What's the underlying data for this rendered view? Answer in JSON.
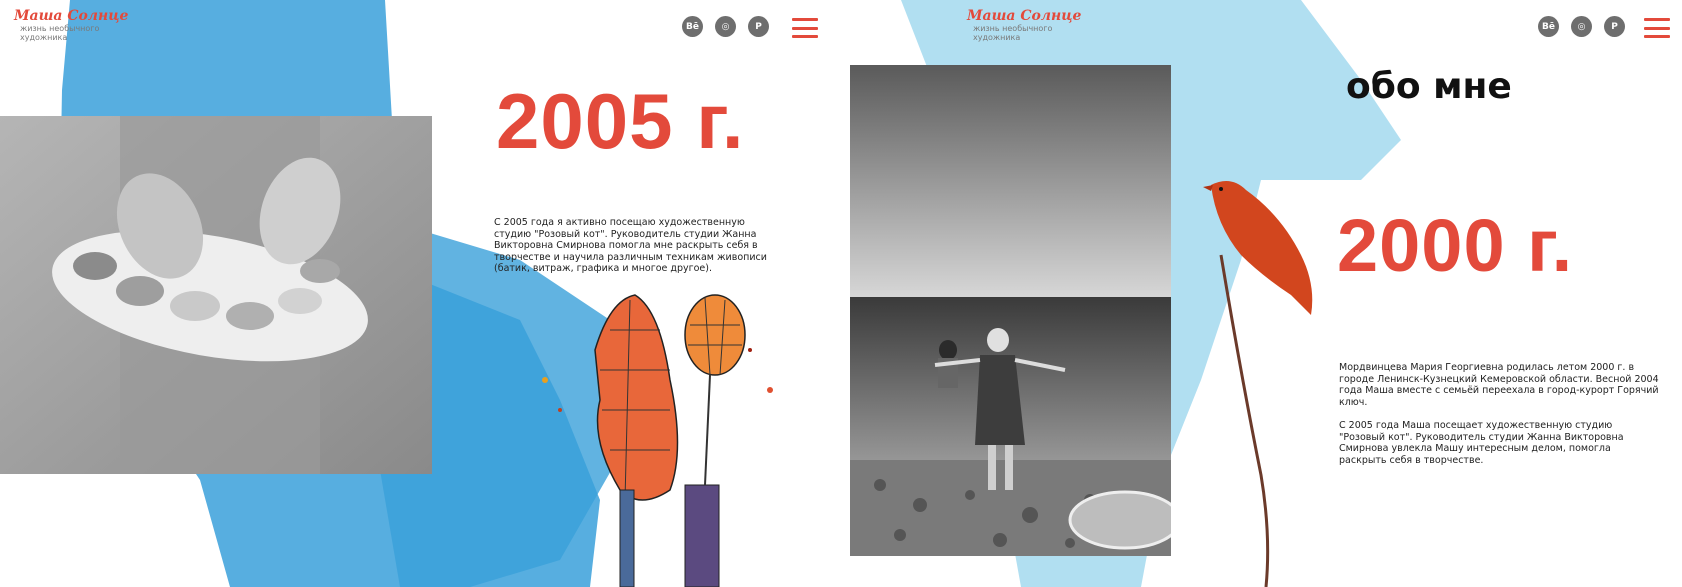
{
  "brand": {
    "logo": "Маша Солнце",
    "tagline": "жизнь необычного художника"
  },
  "social": {
    "behance": "Bē",
    "instagram": "◎",
    "pinterest": "P"
  },
  "colors": {
    "accent": "#e34a3b",
    "splash_blue": "#3aa0da",
    "splash_light": "#a9dcef"
  },
  "left_slide": {
    "year": "2005 г.",
    "text": "С 2005 года я  активно посещаю художественную студию \"Розовый кот\". Руководитель студии Жанна Викторовна Смирнова  помогла мне раскрыть себя в творчестве и научила различным техникам живописи (батик, витраж, графика и многое другое)."
  },
  "right_slide": {
    "title": "обо мне",
    "year": "2000 г.",
    "text1": "Мордвинцева Мария Георгиевна родилась летом 2000 г. в городе Ленинск-Кузнецкий Кемеровской области. Весной 2004 года Маша вместе с семьёй переехала в город-курорт Горячий ключ.",
    "text2": "С 2005 года Маша посещает художественную студию \"Розовый кот\". Руководитель студии Жанна Викторовна Смирнова увлекла Машу интересным делом, помогла раскрыть себя в творчестве."
  }
}
